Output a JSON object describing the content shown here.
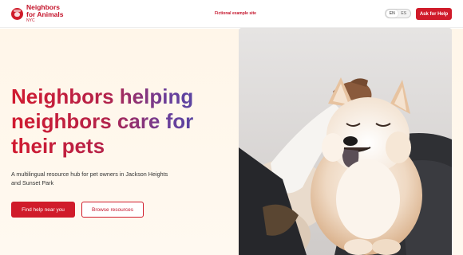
{
  "header": {
    "logo_line1": "Neighbors",
    "logo_line2": "for Animals",
    "logo_sub": "NYC",
    "notice": "Fictional example site",
    "lang_en": "EN",
    "lang_es": "ES",
    "ask_button": "Ask for Help"
  },
  "hero": {
    "headline_line1": "Neighbors helping",
    "headline_line2": "neighbors care for",
    "headline_line3": "their pets",
    "subtext": "A multilingual resource hub for pet owners in Jackson Heights and Sunset Park",
    "primary_button": "Find help near you",
    "secondary_button": "Browse resources"
  },
  "colors": {
    "brand_red": "#d01b2a",
    "hero_bg": "#fff6e9",
    "gradient_end": "#4a4aa8"
  },
  "icons": {
    "logo": "dog-logo-icon"
  }
}
